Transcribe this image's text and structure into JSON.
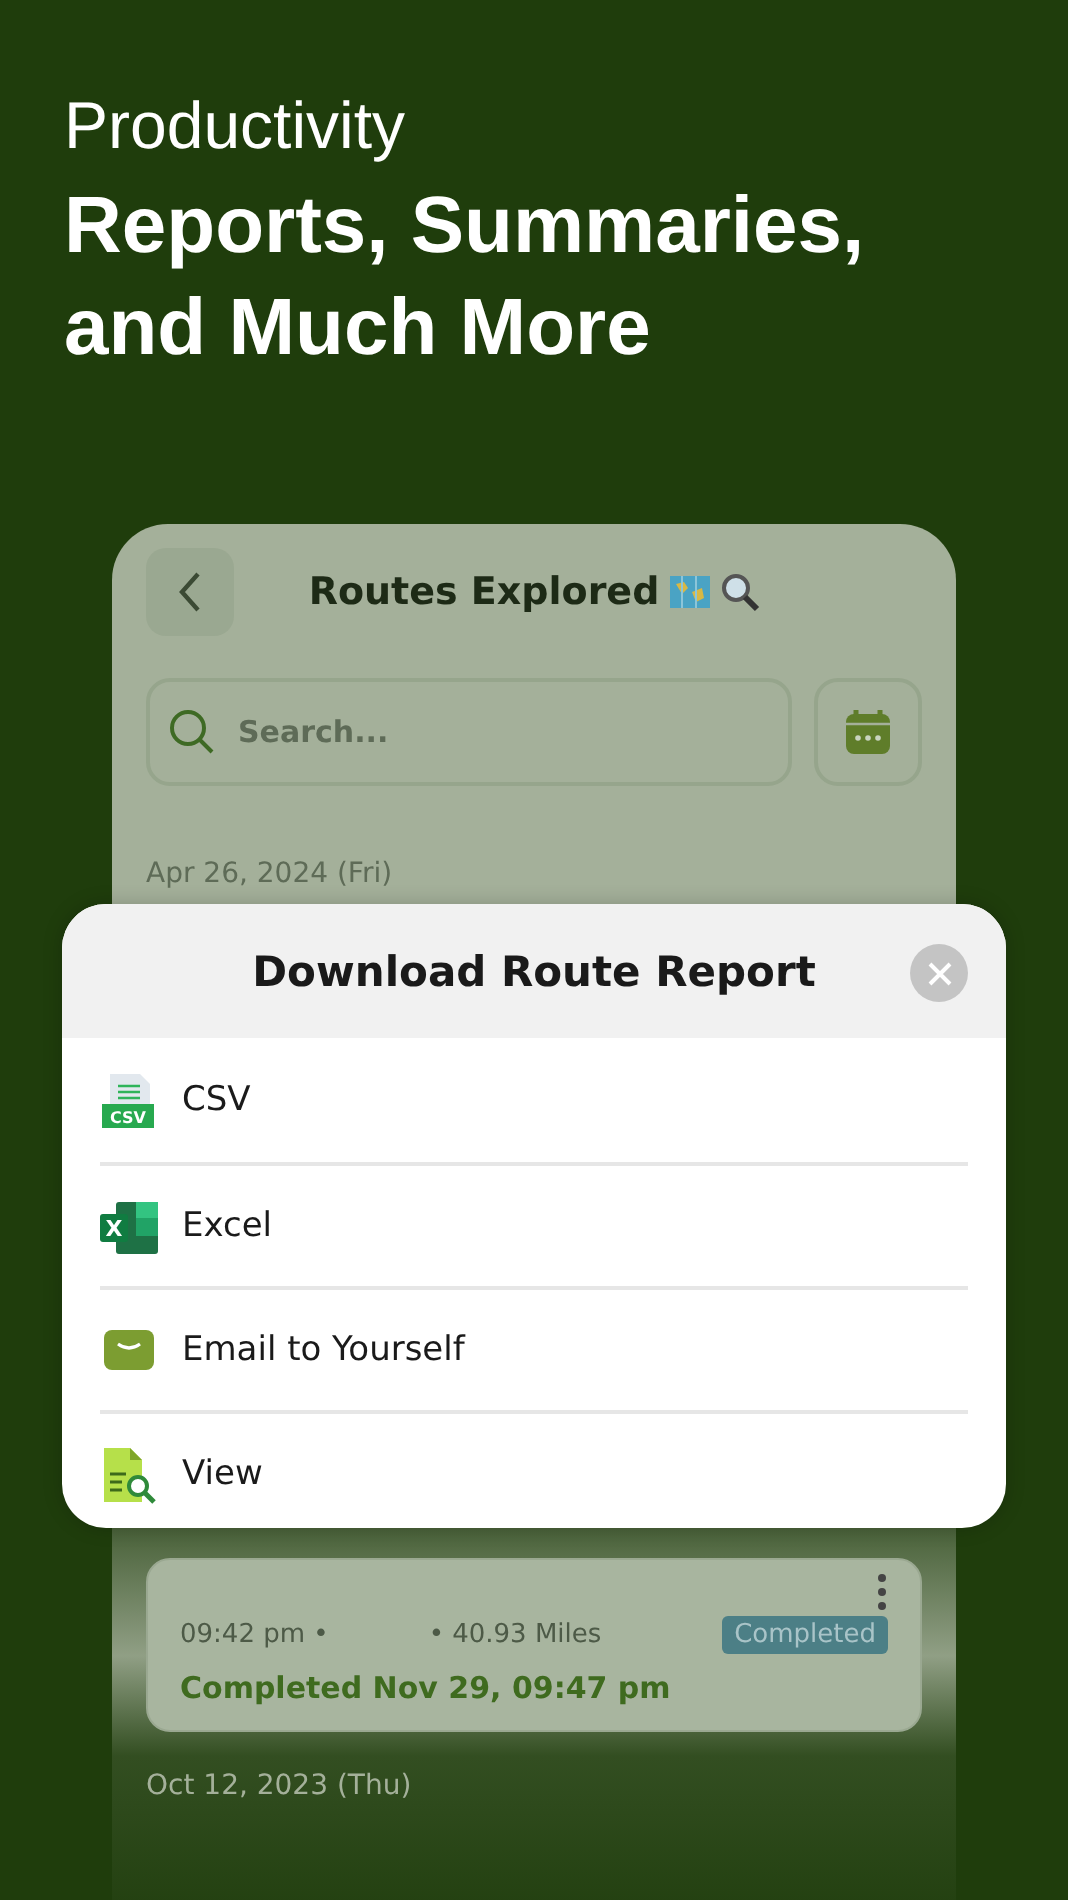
{
  "headline": {
    "eyebrow": "Productivity",
    "title": "Reports, Summaries, and Much More"
  },
  "screen": {
    "title": "Routes Explored",
    "search": {
      "placeholder": "Search..."
    },
    "date_group": "Apr 26, 2024 (Fri)",
    "route": {
      "start_time": "09:42 pm •",
      "distance": "• 40.93 Miles",
      "status": "Completed",
      "completed": "Completed Nov 29, 09:47 pm"
    },
    "next_date_group": "Oct 12, 2023 (Thu)"
  },
  "dialog": {
    "title": "Download Route Report",
    "options": [
      {
        "kind": "csv",
        "label": "CSV",
        "icon_label": "CSV"
      },
      {
        "kind": "excel",
        "label": "Excel",
        "icon_label": "X"
      },
      {
        "kind": "email",
        "label": "Email to Yourself"
      },
      {
        "kind": "view",
        "label": "View"
      }
    ]
  }
}
